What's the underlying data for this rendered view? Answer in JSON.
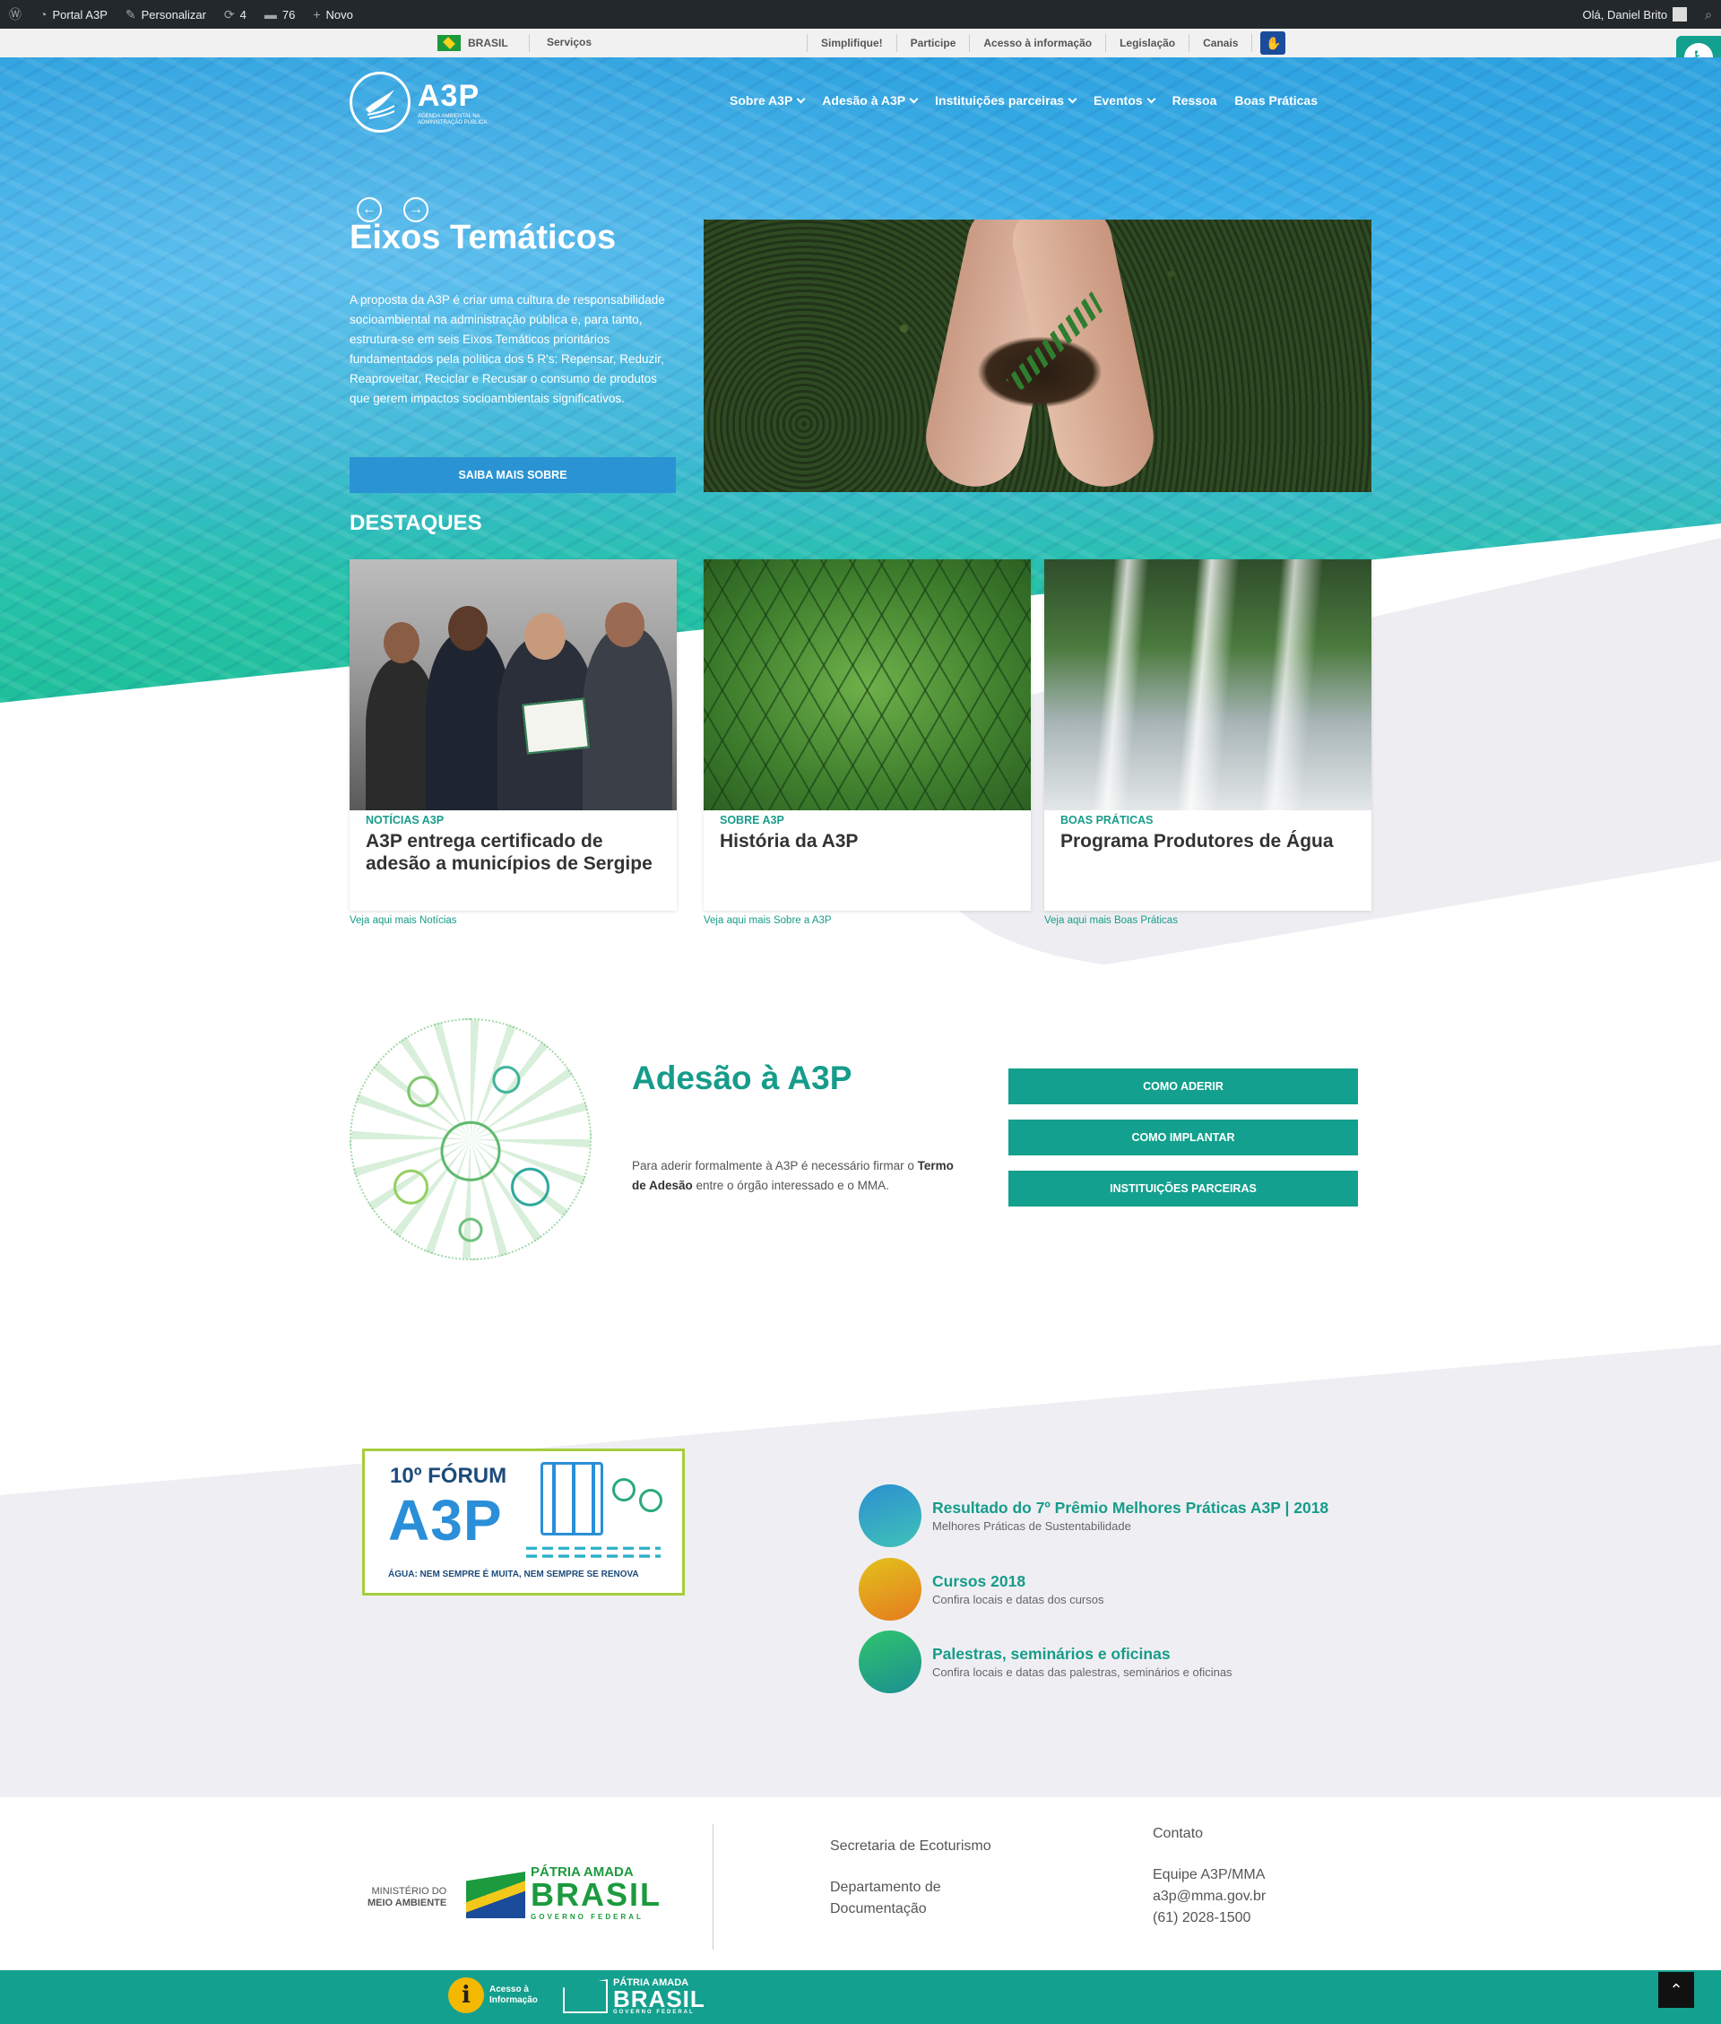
{
  "admin_bar": {
    "site": "Portal A3P",
    "customize": "Personalizar",
    "updates_count": "4",
    "comments_count": "76",
    "new": "Novo",
    "greeting": "Olá, Daniel Brito"
  },
  "gov_bar": {
    "country": "BRASIL",
    "services": "Serviços",
    "links": [
      "Simplifique!",
      "Participe",
      "Acesso à informação",
      "Legislação",
      "Canais"
    ]
  },
  "brand": {
    "name": "A3P",
    "subtitle": "Agenda Ambiental na Administração Pública"
  },
  "nav": {
    "items": [
      {
        "label": "Sobre A3P",
        "has_dropdown": true
      },
      {
        "label": "Adesão à A3P",
        "has_dropdown": true
      },
      {
        "label": "Instituições parceiras",
        "has_dropdown": true
      },
      {
        "label": "Eventos",
        "has_dropdown": true
      },
      {
        "label": "Ressoa",
        "has_dropdown": false
      },
      {
        "label": "Boas Práticas",
        "has_dropdown": false
      }
    ]
  },
  "slide": {
    "title": "Eixos Temáticos",
    "text": "A proposta da A3P é criar uma cultura de responsabilidade socioambiental na administração pública e, para tanto, estrutura-se em seis Eixos Temáticos prioritários fundamentados pela política dos 5 R's: Repensar, Reduzir, Reaproveitar, Reciclar e Recusar o consumo de produtos que gerem impactos socioambientais significativos.",
    "button": "SAIBA MAIS SOBRE"
  },
  "highlights": {
    "title": "DESTAQUES",
    "cards": [
      {
        "category": "NOTÍCIAS A3P",
        "title": "A3P entrega certificado de adesão a municípios de Sergipe",
        "more": "Veja aqui mais Notícias"
      },
      {
        "category": "SOBRE A3P",
        "title": "História da A3P",
        "more": "Veja aqui mais Sobre a A3P"
      },
      {
        "category": "BOAS PRÁTICAS",
        "title": "Programa Produtores de Água",
        "more": "Veja aqui mais Boas Práticas"
      }
    ]
  },
  "adesao": {
    "title": "Adesão à A3P",
    "text_before": "Para aderir formalmente à A3P é necessário firmar o ",
    "text_strong": "Termo de Adesão",
    "text_after": " entre o órgão interessado e o MMA.",
    "buttons": [
      "COMO ADERIR",
      "COMO IMPLANTAR",
      "INSTITUIÇÕES PARCEIRAS"
    ]
  },
  "forum": {
    "line1": "10º FÓRUM",
    "line2": "A3P",
    "tagline": "ÁGUA: NEM SEMPRE É MUITA, NEM SEMPRE SE RENOVA"
  },
  "features": [
    {
      "title": "Resultado do 7º Prêmio Melhores Práticas A3P | 2018",
      "subtitle": "Melhores Práticas de Sustentabilidade",
      "color1": "#2c8fd0",
      "color2": "#3fc2b8"
    },
    {
      "title": "Cursos 2018",
      "subtitle": "Confira locais e datas dos cursos",
      "color1": "#e2c21d",
      "color2": "#e57b1e"
    },
    {
      "title": "Palestras, seminários e oficinas",
      "subtitle": "Confira locais e datas das palestras, seminários e oficinas",
      "color1": "#2ec46c",
      "color2": "#1d8f92"
    }
  ],
  "footer": {
    "ministry_line1": "MINISTÉRIO DO",
    "ministry_line2": "MEIO AMBIENTE",
    "patria_line1": "PÁTRIA AMADA",
    "patria_line2": "BRASIL",
    "patria_line3": "GOVERNO FEDERAL",
    "col1_a": "Secretaria de Ecoturismo",
    "col1_b": "Departamento de Documentação",
    "contact_title": "Contato",
    "contact_lines": [
      "Equipe A3P/MMA",
      "a3p@mma.gov.br",
      "(61) 2028-1500"
    ],
    "access_info_line1": "Acesso à",
    "access_info_line2": "Informação"
  },
  "colors": {
    "accent": "#14a08e",
    "hero_blue": "#2fa3e0",
    "button_blue": "#2a93d3",
    "admin_bar": "#23282d"
  }
}
